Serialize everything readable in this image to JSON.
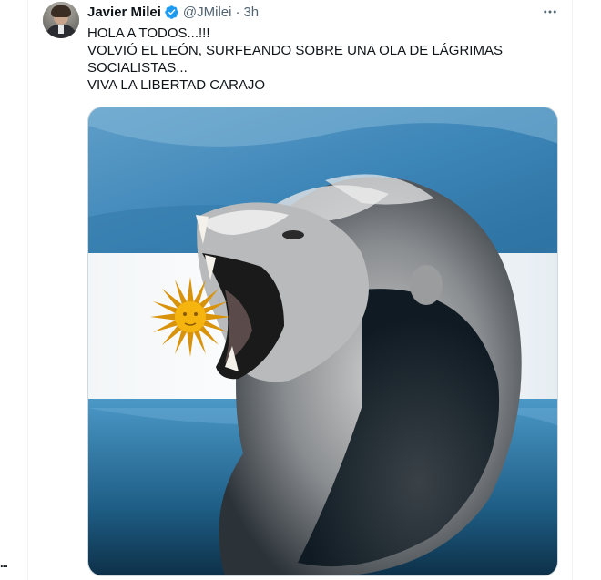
{
  "tweet": {
    "author_name": "Javier Milei",
    "author_handle": "@JMilei",
    "separator": "·",
    "timestamp": "3h",
    "more_label": "•••",
    "text_lines": [
      "HOLA A TODOS...!!!",
      "VOLVIÓ EL LEÓN, SURFEANDO SOBRE UNA OLA DE LÁGRIMAS",
      "SOCIALISTAS...",
      "VIVA LA LIBERTAD CARAJO"
    ],
    "media_icon": "image-icon",
    "verified_icon": "verified-badge-icon"
  },
  "sidebar": {
    "more_label": "..."
  },
  "colors": {
    "verified_blue": "#1d9bf0",
    "flag_blue": "#74acdf",
    "flag_white": "#ffffff",
    "sun_gold": "#f6b40e"
  }
}
